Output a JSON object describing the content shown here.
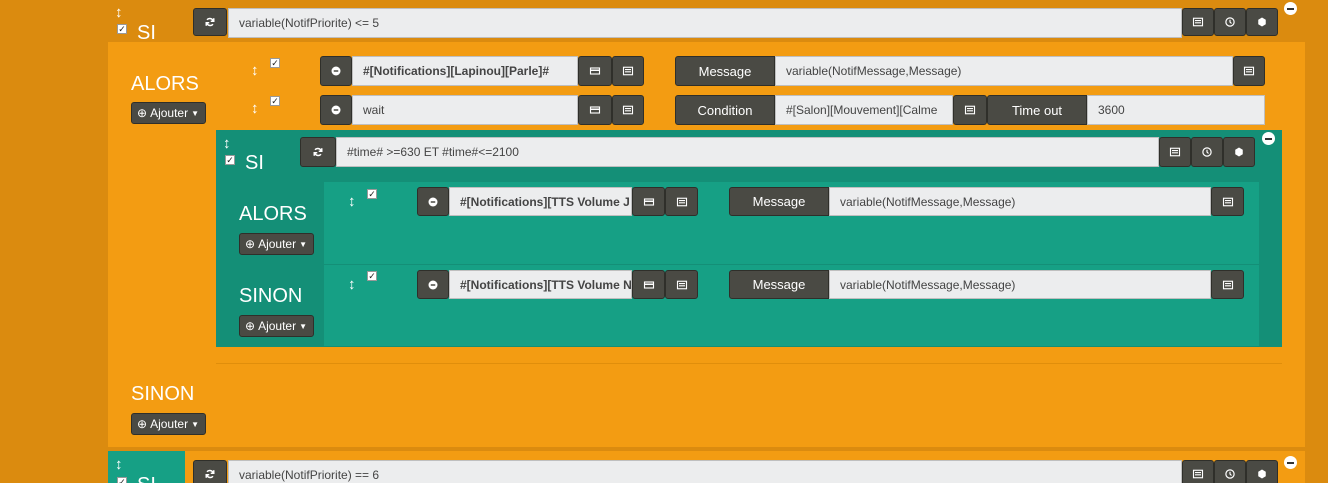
{
  "blocks": {
    "si_top": {
      "label": "SI",
      "condition": "variable(NotifPriorite) <= 5"
    },
    "alors_top": {
      "label": "ALORS",
      "add": "Ajouter"
    },
    "action1": {
      "cmd": "#[Notifications][Lapinou][Parle]#",
      "param_label": "Message",
      "param_value": "variable(NotifMessage,Message)"
    },
    "action2": {
      "cmd": "wait",
      "param_label": "Condition",
      "param_value": "#[Salon][Mouvement][Calme",
      "timeout_label": "Time out",
      "timeout_value": "3600"
    },
    "si_inner": {
      "label": "SI",
      "condition": "#time# >=630 ET #time#<=2100"
    },
    "alors_inner": {
      "label": "ALORS",
      "add": "Ajouter",
      "cmd": "#[Notifications][TTS Volume J",
      "param_label": "Message",
      "param_value": "variable(NotifMessage,Message)"
    },
    "sinon_inner": {
      "label": "SINON",
      "add": "Ajouter",
      "cmd": "#[Notifications][TTS Volume N",
      "param_label": "Message",
      "param_value": "variable(NotifMessage,Message)"
    },
    "sinon_top": {
      "label": "SINON",
      "add": "Ajouter"
    },
    "si_bottom": {
      "label": "SI",
      "condition": "variable(NotifPriorite) == 6"
    }
  },
  "colors": {
    "orange_bg": "#db8b0f",
    "orange_block": "#f39c12",
    "teal_outer": "#148f77",
    "teal_inner": "#16a085",
    "dark_btn": "#4a4a44"
  }
}
